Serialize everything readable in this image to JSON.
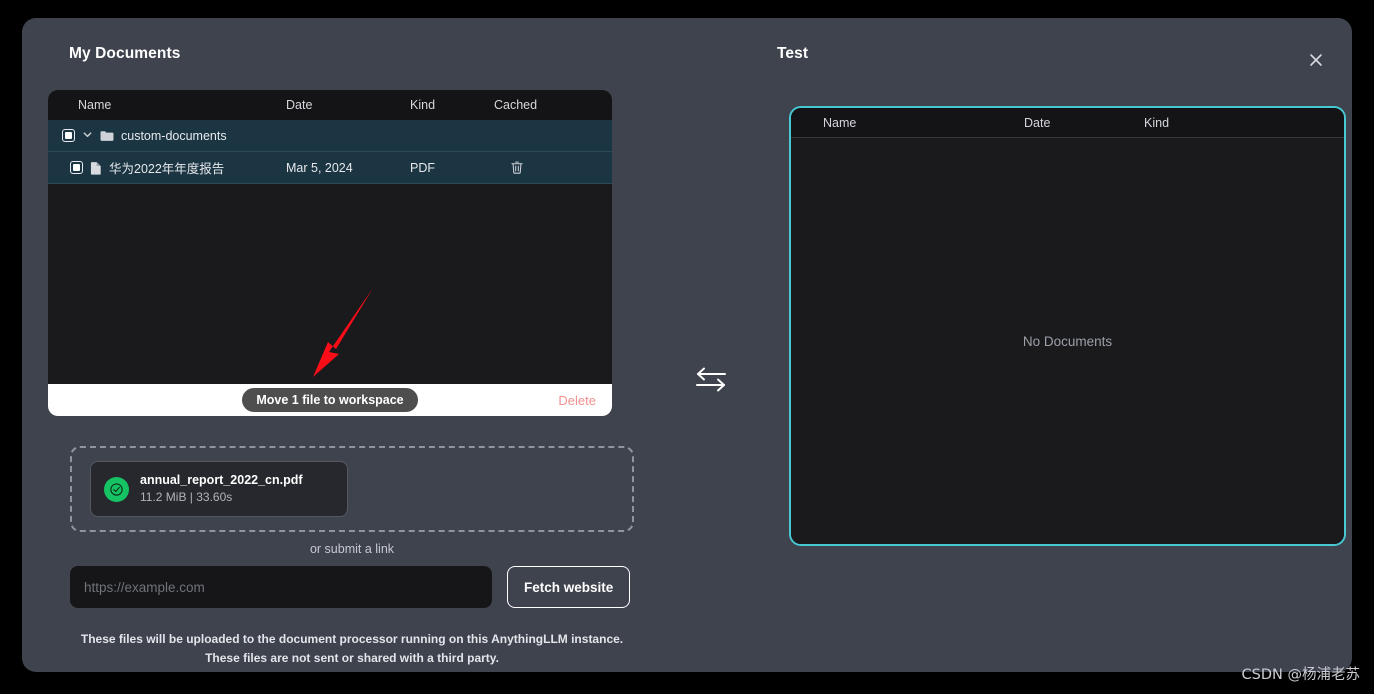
{
  "modal": {
    "close_icon": "close-icon"
  },
  "left": {
    "title": "My Documents",
    "columns": [
      "Name",
      "Date",
      "Kind",
      "Cached"
    ],
    "rows": [
      {
        "type": "folder",
        "name": "custom-documents",
        "date": "",
        "kind": "",
        "selected": true,
        "expanded": true,
        "checked": true
      },
      {
        "type": "file",
        "name": "华为2022年年度报告",
        "date": "Mar 5, 2024",
        "kind": "PDF",
        "selected": true,
        "checked": true,
        "has_delete": true
      }
    ],
    "footer": {
      "move_label": "Move 1 file to workspace",
      "delete_label": "Delete"
    }
  },
  "right": {
    "title": "Test",
    "columns": [
      "Name",
      "Date",
      "Kind"
    ],
    "empty_text": "No Documents",
    "border_color": "#47c8d2"
  },
  "transfer": {
    "icon": "swap-arrows-icon"
  },
  "upload": {
    "file": {
      "name": "annual_report_2022_cn.pdf",
      "meta": "11.2 MiB | 33.60s",
      "status_icon": "check-circle-icon",
      "status_color": "#16c364"
    },
    "or_submit_label": "or submit a link",
    "url_placeholder": "https://example.com",
    "url_value": "",
    "fetch_label": "Fetch website",
    "disclaimer_line1": "These files will be uploaded to the document processor running on this AnythingLLM instance.",
    "disclaimer_line2": "These files are not sent or shared with a third party."
  },
  "annotation": {
    "arrow_color": "#fb0d17"
  },
  "watermark": {
    "text": "CSDN @杨浦老苏"
  }
}
